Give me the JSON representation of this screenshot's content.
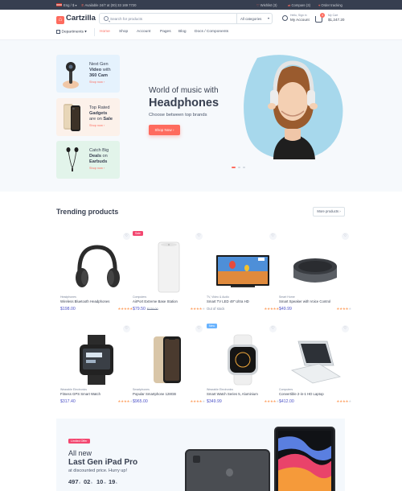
{
  "topbar": {
    "lang": "Eng / $",
    "support": "Available 24/7 at (00) 33 169 7720",
    "wishlist": "Wishlist (3)",
    "compare": "Compare (3)",
    "order_tracking": "Order tracking"
  },
  "header": {
    "brand": "Cartzilla",
    "search_placeholder": "Search for products",
    "category_select": "All categories",
    "account_hello": "Hello, Sign in",
    "account_label": "My Account",
    "cart_count": "4",
    "cart_label": "My Cart",
    "cart_total": "$1,247.20"
  },
  "menu": {
    "departments": "Departments",
    "items": [
      "Home",
      "Shop",
      "Account",
      "Pages",
      "Blog",
      "Docs / Components"
    ]
  },
  "promos": [
    {
      "line1": "Next Gen",
      "line2": "Video",
      "line2b": "with",
      "line3": "360 Cam",
      "shop": "Shop now",
      "bg": "#e5f2fd"
    },
    {
      "line1": "Top Rated",
      "line2": "Gadgets",
      "line2b": "",
      "line3": "are on Sale",
      "shop": "Shop now",
      "bg": "#fcf1ea"
    },
    {
      "line1": "Catch Big",
      "line2": "Deals",
      "line2b": "on",
      "line3": "Earbuds",
      "shop": "Shop now",
      "bg": "#e2f4ea"
    }
  ],
  "hero": {
    "subtitle": "World of music with",
    "title": "Headphones",
    "caption": "Choose between top brands",
    "button": "Shop Now"
  },
  "trending": {
    "title": "Trending products",
    "more": "More products",
    "products": [
      {
        "category": "Headphones",
        "name": "Wireless Bluetooth Headphones",
        "price": "$198.00",
        "old": "",
        "badge": "",
        "stock": "",
        "rating": 5
      },
      {
        "category": "Computers",
        "name": "AirPort Extreme Base Station",
        "price": "$79.50",
        "old": "$129.00",
        "badge": "Sale",
        "stock": "",
        "rating": 4
      },
      {
        "category": "TV, Video & Audio",
        "name": "Smart TV LED 49\" Ultra HD",
        "price": "",
        "old": "",
        "badge": "",
        "stock": "Out of stock",
        "rating": 5
      },
      {
        "category": "Smart Home",
        "name": "Smart Speaker with Voice Control",
        "price": "$49.99",
        "old": "",
        "badge": "",
        "stock": "",
        "rating": 4
      },
      {
        "category": "Wearable Electronics",
        "name": "Fitness GPS Smart Watch",
        "price": "$317.40",
        "old": "",
        "badge": "",
        "stock": "",
        "rating": 4
      },
      {
        "category": "Smartphones",
        "name": "Popular Smartphone 128GB",
        "price": "$965.00",
        "old": "",
        "badge": "",
        "stock": "",
        "rating": 4
      },
      {
        "category": "Wearable Electronics",
        "name": "Smart Watch Series 5, Aluminium",
        "price": "$349.99",
        "old": "",
        "badge": "New",
        "stock": "",
        "rating": 4
      },
      {
        "category": "Computers",
        "name": "Convertible 2-in-1 HD Laptop",
        "price": "$412.00",
        "old": "",
        "badge": "",
        "stock": "",
        "rating": 4
      }
    ]
  },
  "banner": {
    "label": "Limited Offer",
    "line1": "All new",
    "line2": "Last Gen iPad Pro",
    "line3": "at discounted price. Hurry up!",
    "countdown": [
      {
        "value": "497",
        "unit": "d"
      },
      {
        "value": "02",
        "unit": "h"
      },
      {
        "value": "10",
        "unit": "m"
      },
      {
        "value": "19",
        "unit": "s"
      }
    ]
  },
  "colors": {
    "accent": "#fe6b5e",
    "price": "#4e54c8",
    "star": "#fea569",
    "dark": "#373f50",
    "sale": "#f34770",
    "new": "#69b3fe"
  },
  "icons": [
    "flag-us-icon",
    "phone-icon",
    "heart-icon",
    "compare-icon",
    "location-icon",
    "search-icon",
    "user-icon",
    "cart-icon",
    "grid-icon",
    "chevron-right-icon"
  ]
}
